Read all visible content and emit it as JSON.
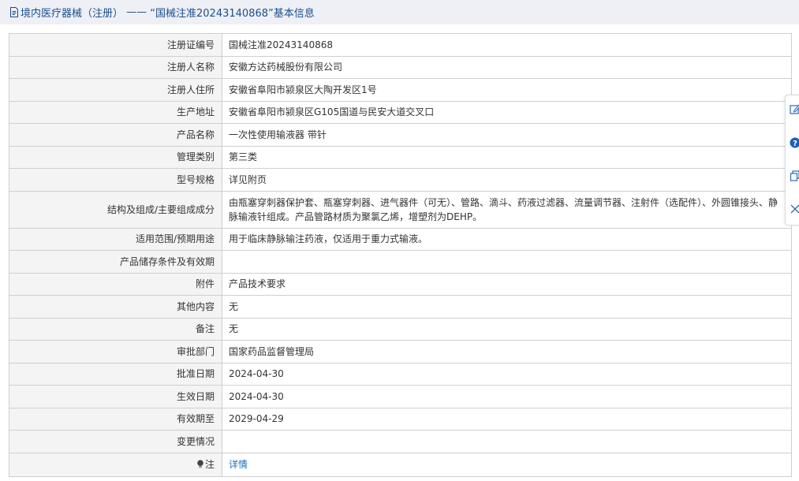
{
  "header": {
    "prefix": "境内医疗器械（注册）",
    "separator": " —— ",
    "record_title": "“国械注准20243140868”基本信息"
  },
  "rows": [
    {
      "label": "注册证编号",
      "value": "国械注准20243140868"
    },
    {
      "label": "注册人名称",
      "value": "安徽方达药械股份有限公司"
    },
    {
      "label": "注册人住所",
      "value": "安徽省阜阳市颍泉区大陶开发区1号"
    },
    {
      "label": "生产地址",
      "value": "安徽省阜阳市颍泉区G105国道与民安大道交叉口"
    },
    {
      "label": "产品名称",
      "value": "一次性使用输液器 带针"
    },
    {
      "label": "管理类别",
      "value": "第三类"
    },
    {
      "label": "型号规格",
      "value": "详见附页"
    },
    {
      "label": "结构及组成/主要组成成分",
      "value": "由瓶塞穿刺器保护套、瓶塞穿刺器、进气器件（可无）、管路、滴斗、药液过滤器、流量调节器、注射件（选配件）、外圆锥接头、静脉输液针组成。产品管路材质为聚氯乙烯，增塑剂为DEHP。"
    },
    {
      "label": "适用范围/预期用途",
      "value": "用于临床静脉输注药液，仅适用于重力式输液。"
    },
    {
      "label": "产品储存条件及有效期",
      "value": ""
    },
    {
      "label": "附件",
      "value": "产品技术要求"
    },
    {
      "label": "其他内容",
      "value": "无"
    },
    {
      "label": "备注",
      "value": "无"
    },
    {
      "label": "审批部门",
      "value": "国家药品监督管理局"
    },
    {
      "label": "批准日期",
      "value": "2024-04-30"
    },
    {
      "label": "生效日期",
      "value": "2024-04-30"
    },
    {
      "label": "有效期至",
      "value": "2029-04-29"
    },
    {
      "label": "变更情况",
      "value": ""
    }
  ],
  "note_row": {
    "label": "注",
    "link_text": "详情"
  },
  "side_tools": [
    "edit-icon",
    "help-icon",
    "copy-icon",
    "close-icon"
  ],
  "colors": {
    "header_bg": "#eef0f6",
    "header_text": "#1a4e8c",
    "label_bg": "#f4f4f4",
    "border": "#cfcfcf",
    "link": "#1a6fc4"
  }
}
